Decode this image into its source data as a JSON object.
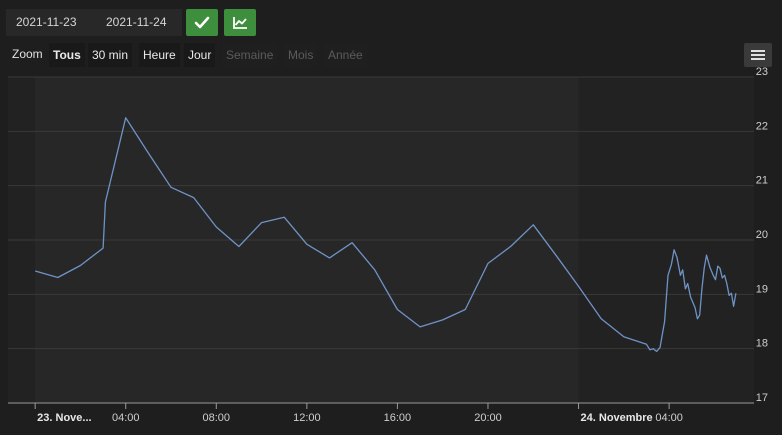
{
  "toolbar": {
    "date_start": "2021-11-23",
    "date_end": "2021-11-24",
    "validate_icon": "check-icon",
    "chart_icon": "line-chart-icon",
    "button_color": "#3d8f3d"
  },
  "zoom": {
    "label": "Zoom",
    "buttons": [
      {
        "label": "Tous",
        "state": "active"
      },
      {
        "label": "30 min",
        "state": "enabled"
      },
      {
        "label": "Heure",
        "state": "enabled"
      },
      {
        "label": "Jour",
        "state": "enabled"
      },
      {
        "label": "Semaine",
        "state": "disabled"
      },
      {
        "label": "Mois",
        "state": "disabled"
      },
      {
        "label": "Année",
        "state": "disabled"
      }
    ]
  },
  "menu_icon": "hamburger-icon",
  "chart_data": {
    "type": "line",
    "series_color": "#6f93c6",
    "ylim": [
      17,
      23
    ],
    "yticks": [
      17,
      18,
      19,
      20,
      21,
      22,
      23
    ],
    "xlim": [
      -1.2,
      31.75
    ],
    "xticks": [
      {
        "x": 0,
        "label": "23. Nove...",
        "bold": true
      },
      {
        "x": 4,
        "label": "04:00",
        "bold": false
      },
      {
        "x": 8,
        "label": "08:00",
        "bold": false
      },
      {
        "x": 12,
        "label": "12:00",
        "bold": false
      },
      {
        "x": 16,
        "label": "16:00",
        "bold": false
      },
      {
        "x": 20,
        "label": "20:00",
        "bold": false
      },
      {
        "x": 24,
        "label": "24. Novembre",
        "bold": true
      },
      {
        "x": 28,
        "label": "04:00",
        "bold": false
      }
    ],
    "points": [
      [
        0.0,
        19.43
      ],
      [
        1.0,
        19.31
      ],
      [
        2.0,
        19.53
      ],
      [
        3.0,
        19.85
      ],
      [
        3.1,
        20.7
      ],
      [
        4.0,
        22.25
      ],
      [
        5.0,
        21.6
      ],
      [
        6.0,
        20.97
      ],
      [
        7.0,
        20.78
      ],
      [
        8.0,
        20.24
      ],
      [
        9.0,
        19.88
      ],
      [
        10.0,
        20.32
      ],
      [
        11.0,
        20.42
      ],
      [
        12.0,
        19.92
      ],
      [
        13.0,
        19.67
      ],
      [
        14.0,
        19.95
      ],
      [
        15.0,
        19.45
      ],
      [
        16.0,
        18.72
      ],
      [
        17.0,
        18.4
      ],
      [
        18.0,
        18.53
      ],
      [
        19.0,
        18.72
      ],
      [
        20.0,
        19.57
      ],
      [
        21.0,
        19.88
      ],
      [
        22.0,
        20.28
      ],
      [
        23.0,
        19.72
      ],
      [
        24.0,
        19.15
      ],
      [
        25.0,
        18.55
      ],
      [
        26.0,
        18.22
      ],
      [
        27.0,
        18.08
      ],
      [
        27.15,
        17.98
      ],
      [
        27.3,
        18.0
      ],
      [
        27.45,
        17.95
      ],
      [
        27.6,
        18.02
      ],
      [
        27.8,
        18.5
      ],
      [
        27.95,
        19.35
      ],
      [
        28.1,
        19.55
      ],
      [
        28.22,
        19.82
      ],
      [
        28.35,
        19.68
      ],
      [
        28.5,
        19.35
      ],
      [
        28.6,
        19.45
      ],
      [
        28.72,
        19.1
      ],
      [
        28.82,
        19.2
      ],
      [
        28.95,
        18.95
      ],
      [
        29.05,
        18.85
      ],
      [
        29.15,
        18.75
      ],
      [
        29.25,
        18.55
      ],
      [
        29.35,
        18.62
      ],
      [
        29.45,
        19.1
      ],
      [
        29.55,
        19.48
      ],
      [
        29.65,
        19.72
      ],
      [
        29.8,
        19.5
      ],
      [
        29.95,
        19.35
      ],
      [
        30.05,
        19.27
      ],
      [
        30.15,
        19.52
      ],
      [
        30.25,
        19.48
      ],
      [
        30.35,
        19.3
      ],
      [
        30.45,
        19.35
      ],
      [
        30.55,
        19.2
      ],
      [
        30.65,
        18.98
      ],
      [
        30.75,
        19.02
      ],
      [
        30.85,
        18.78
      ],
      [
        30.95,
        19.02
      ]
    ]
  }
}
